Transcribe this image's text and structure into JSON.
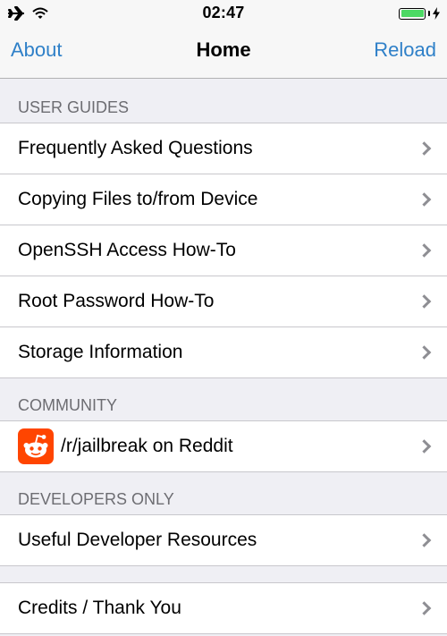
{
  "status_bar": {
    "time": "02:47",
    "icons": [
      "airplane-icon",
      "wifi-icon",
      "battery-icon",
      "charging-icon"
    ],
    "battery_level": 1.0
  },
  "nav": {
    "left_label": "About",
    "title": "Home",
    "right_label": "Reload"
  },
  "sections": {
    "user_guides": {
      "header": "USER GUIDES",
      "items": [
        {
          "label": "Frequently Asked Questions"
        },
        {
          "label": "Copying Files to/from Device"
        },
        {
          "label": "OpenSSH Access How-To"
        },
        {
          "label": "Root Password How-To"
        },
        {
          "label": "Storage Information"
        }
      ]
    },
    "community": {
      "header": "COMMUNITY",
      "items": [
        {
          "label": "/r/jailbreak on Reddit",
          "icon": "reddit-icon"
        }
      ]
    },
    "developers": {
      "header": "DEVELOPERS ONLY",
      "items": [
        {
          "label": "Useful Developer Resources"
        }
      ]
    },
    "credits": {
      "items": [
        {
          "label": "Credits / Thank You"
        }
      ]
    }
  },
  "colors": {
    "accent": "#2f80c8",
    "background": "#efeff4",
    "reddit": "#ff4500",
    "battery": "#4cd964"
  }
}
